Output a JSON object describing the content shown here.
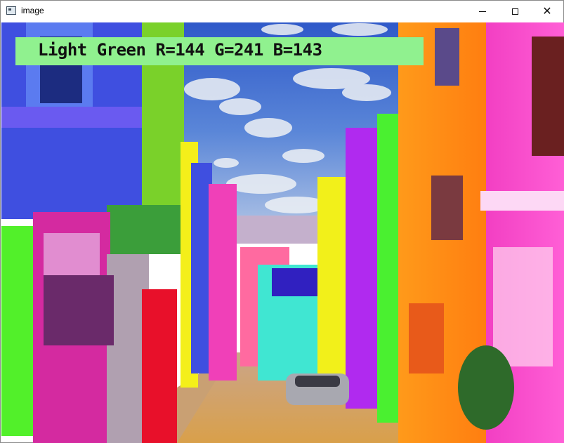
{
  "window": {
    "title": "image",
    "icon": "app-window-icon",
    "controls": {
      "minimize_icon": "minimize-icon",
      "maximize_icon": "maximize-icon",
      "close_icon": "close-icon",
      "close_glyph": "✕"
    }
  },
  "overlay": {
    "text": "Light Green R=144 G=241 B=143",
    "background_color": "#90F18F",
    "text_color": "#111111"
  },
  "image": {
    "subject": "colorful-street-photo"
  }
}
